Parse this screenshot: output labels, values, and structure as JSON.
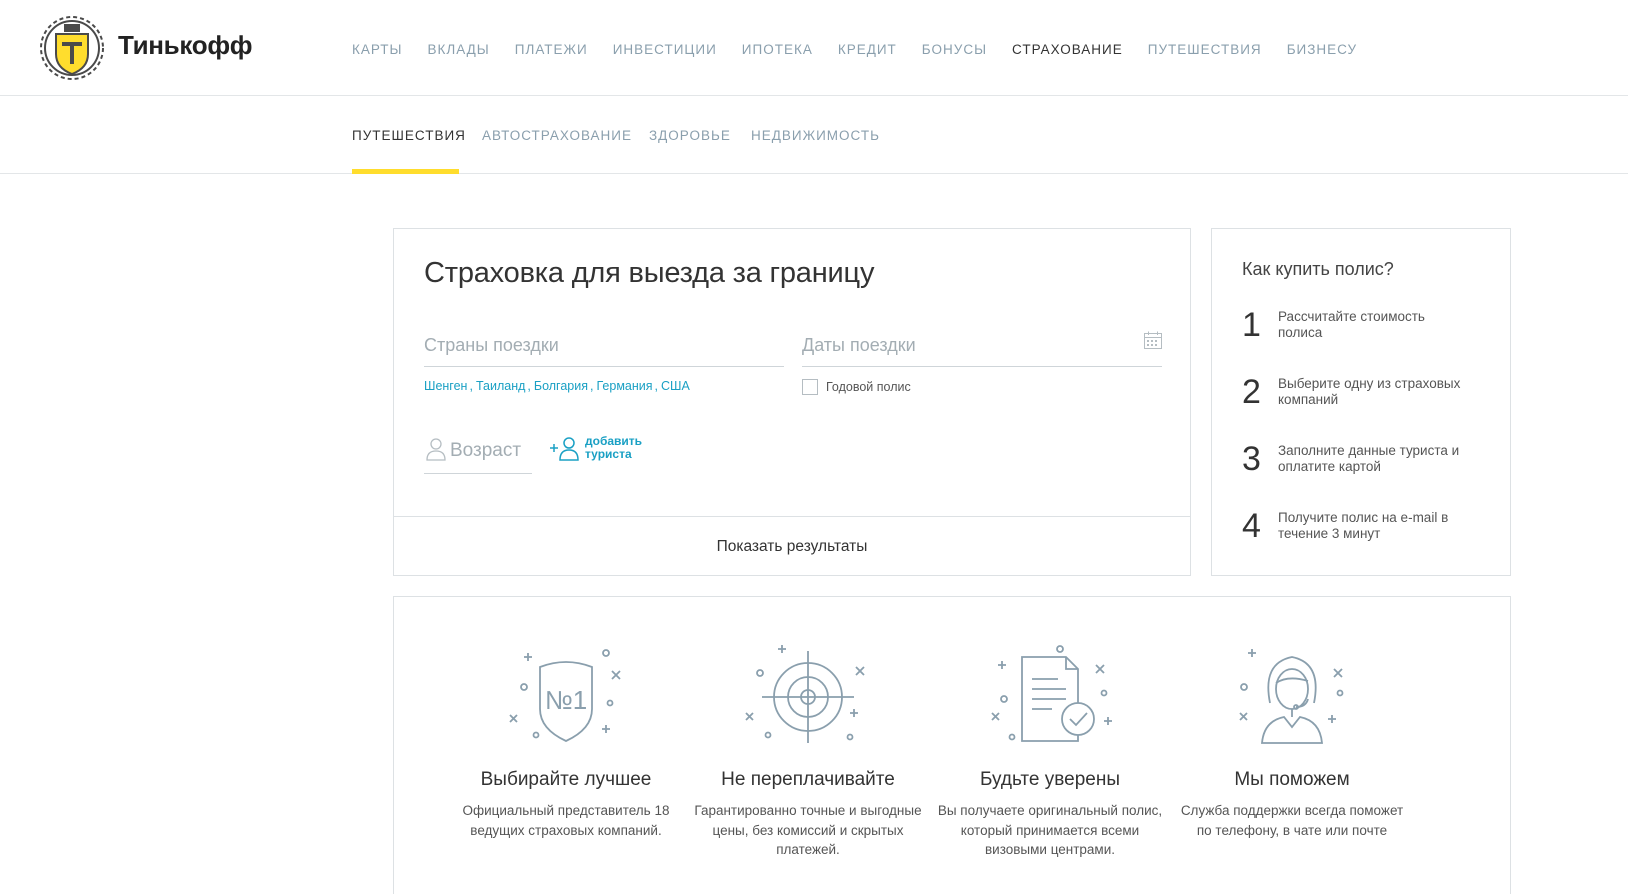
{
  "brand": {
    "name": "Тинькофф",
    "logo_icon": "tinkoff-crest-icon",
    "accent_color": "#ffdd2d"
  },
  "main_nav": {
    "items": [
      {
        "label": "КАРТЫ",
        "active": false
      },
      {
        "label": "ВКЛАДЫ",
        "active": false
      },
      {
        "label": "ПЛАТЕЖИ",
        "active": false
      },
      {
        "label": "ИНВЕСТИЦИИ",
        "active": false
      },
      {
        "label": "ИПОТЕКА",
        "active": false
      },
      {
        "label": "КРЕДИТ",
        "active": false
      },
      {
        "label": "БОНУСЫ",
        "active": false
      },
      {
        "label": "СТРАХОВАНИЕ",
        "active": true
      },
      {
        "label": "ПУТЕШЕСТВИЯ",
        "active": false
      },
      {
        "label": "БИЗНЕСУ",
        "active": false
      }
    ]
  },
  "sub_nav": {
    "tabs": [
      {
        "label": "ПУТЕШЕСТВИЯ",
        "active": true
      },
      {
        "label": "АВТОСТРАХОВАНИЕ",
        "active": false
      },
      {
        "label": "ЗДОРОВЬЕ",
        "active": false
      },
      {
        "label": "НЕДВИЖИМОСТЬ",
        "active": false
      }
    ]
  },
  "calculator": {
    "title": "Страховка для выезда за границу",
    "countries_placeholder": "Страны поездки",
    "dates_placeholder": "Даты поездки",
    "calendar_icon": "calendar-icon",
    "quick_countries": [
      "Шенген",
      "Таиланд",
      "Болгария",
      "Германия",
      "США"
    ],
    "quick_separator": ",",
    "annual_policy_label": "Годовой полис",
    "annual_policy_checked": false,
    "age_placeholder": "Возраст",
    "add_tourist_label": "добавить туриста",
    "submit_label": "Показать результаты"
  },
  "howto": {
    "title": "Как купить полис?",
    "steps": [
      {
        "num": "1",
        "text": "Рассчитайте стоимость полиса"
      },
      {
        "num": "2",
        "text": "Выберите одну из страховых компаний"
      },
      {
        "num": "3",
        "text": "Заполните данные туриста и оплатите картой"
      },
      {
        "num": "4",
        "text": "Получите полис на e-mail в течение 3 минут"
      }
    ]
  },
  "features": [
    {
      "icon": "shield-no1-icon",
      "badge": "№1",
      "title": "Выбирайте лучшее",
      "text": "Официальный представитель 18 ведущих страховых компаний."
    },
    {
      "icon": "target-icon",
      "title": "Не переплачивайте",
      "text": "Гарантированно точные и выгодные цены, без комиссий и скрытых платежей."
    },
    {
      "icon": "document-check-icon",
      "title": "Будьте уверены",
      "text": "Вы получаете оригинальный полис, который принимается всеми визовыми центрами."
    },
    {
      "icon": "support-agent-icon",
      "title": "Мы поможем",
      "text": "Служба поддержки всегда поможет по телефону, в чате или почте"
    }
  ]
}
